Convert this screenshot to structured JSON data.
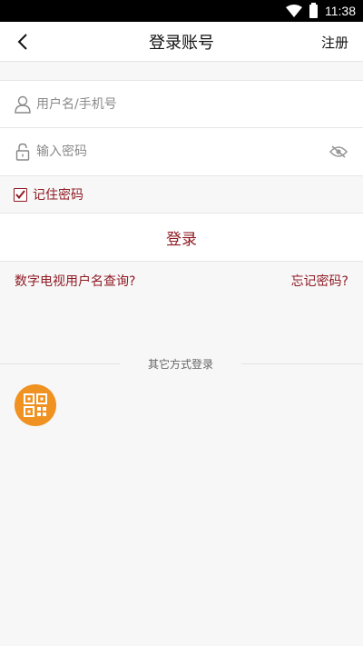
{
  "status_bar": {
    "time": "11:38",
    "icons": [
      "wifi-icon",
      "battery-icon"
    ]
  },
  "nav": {
    "back_icon": "chevron-left-icon",
    "title": "登录账号",
    "register_label": "注册"
  },
  "form": {
    "username": {
      "placeholder": "用户名/手机号",
      "value": "",
      "icon": "user-icon"
    },
    "password": {
      "placeholder": "输入密码",
      "value": "",
      "icon": "lock-icon",
      "toggle_icon": "eye-icon"
    },
    "remember": {
      "label": "记住密码",
      "checked": true
    }
  },
  "login_button": {
    "label": "登录"
  },
  "links": {
    "query_username": "数字电视用户名查询?",
    "forgot_password": "忘记密码?"
  },
  "alt_login": {
    "divider_text": "其它方式登录",
    "qr_icon": "qr-code-icon"
  },
  "colors": {
    "accent": "#8f1b24",
    "qr_bg": "#f09221",
    "background": "#f7f7f7"
  }
}
